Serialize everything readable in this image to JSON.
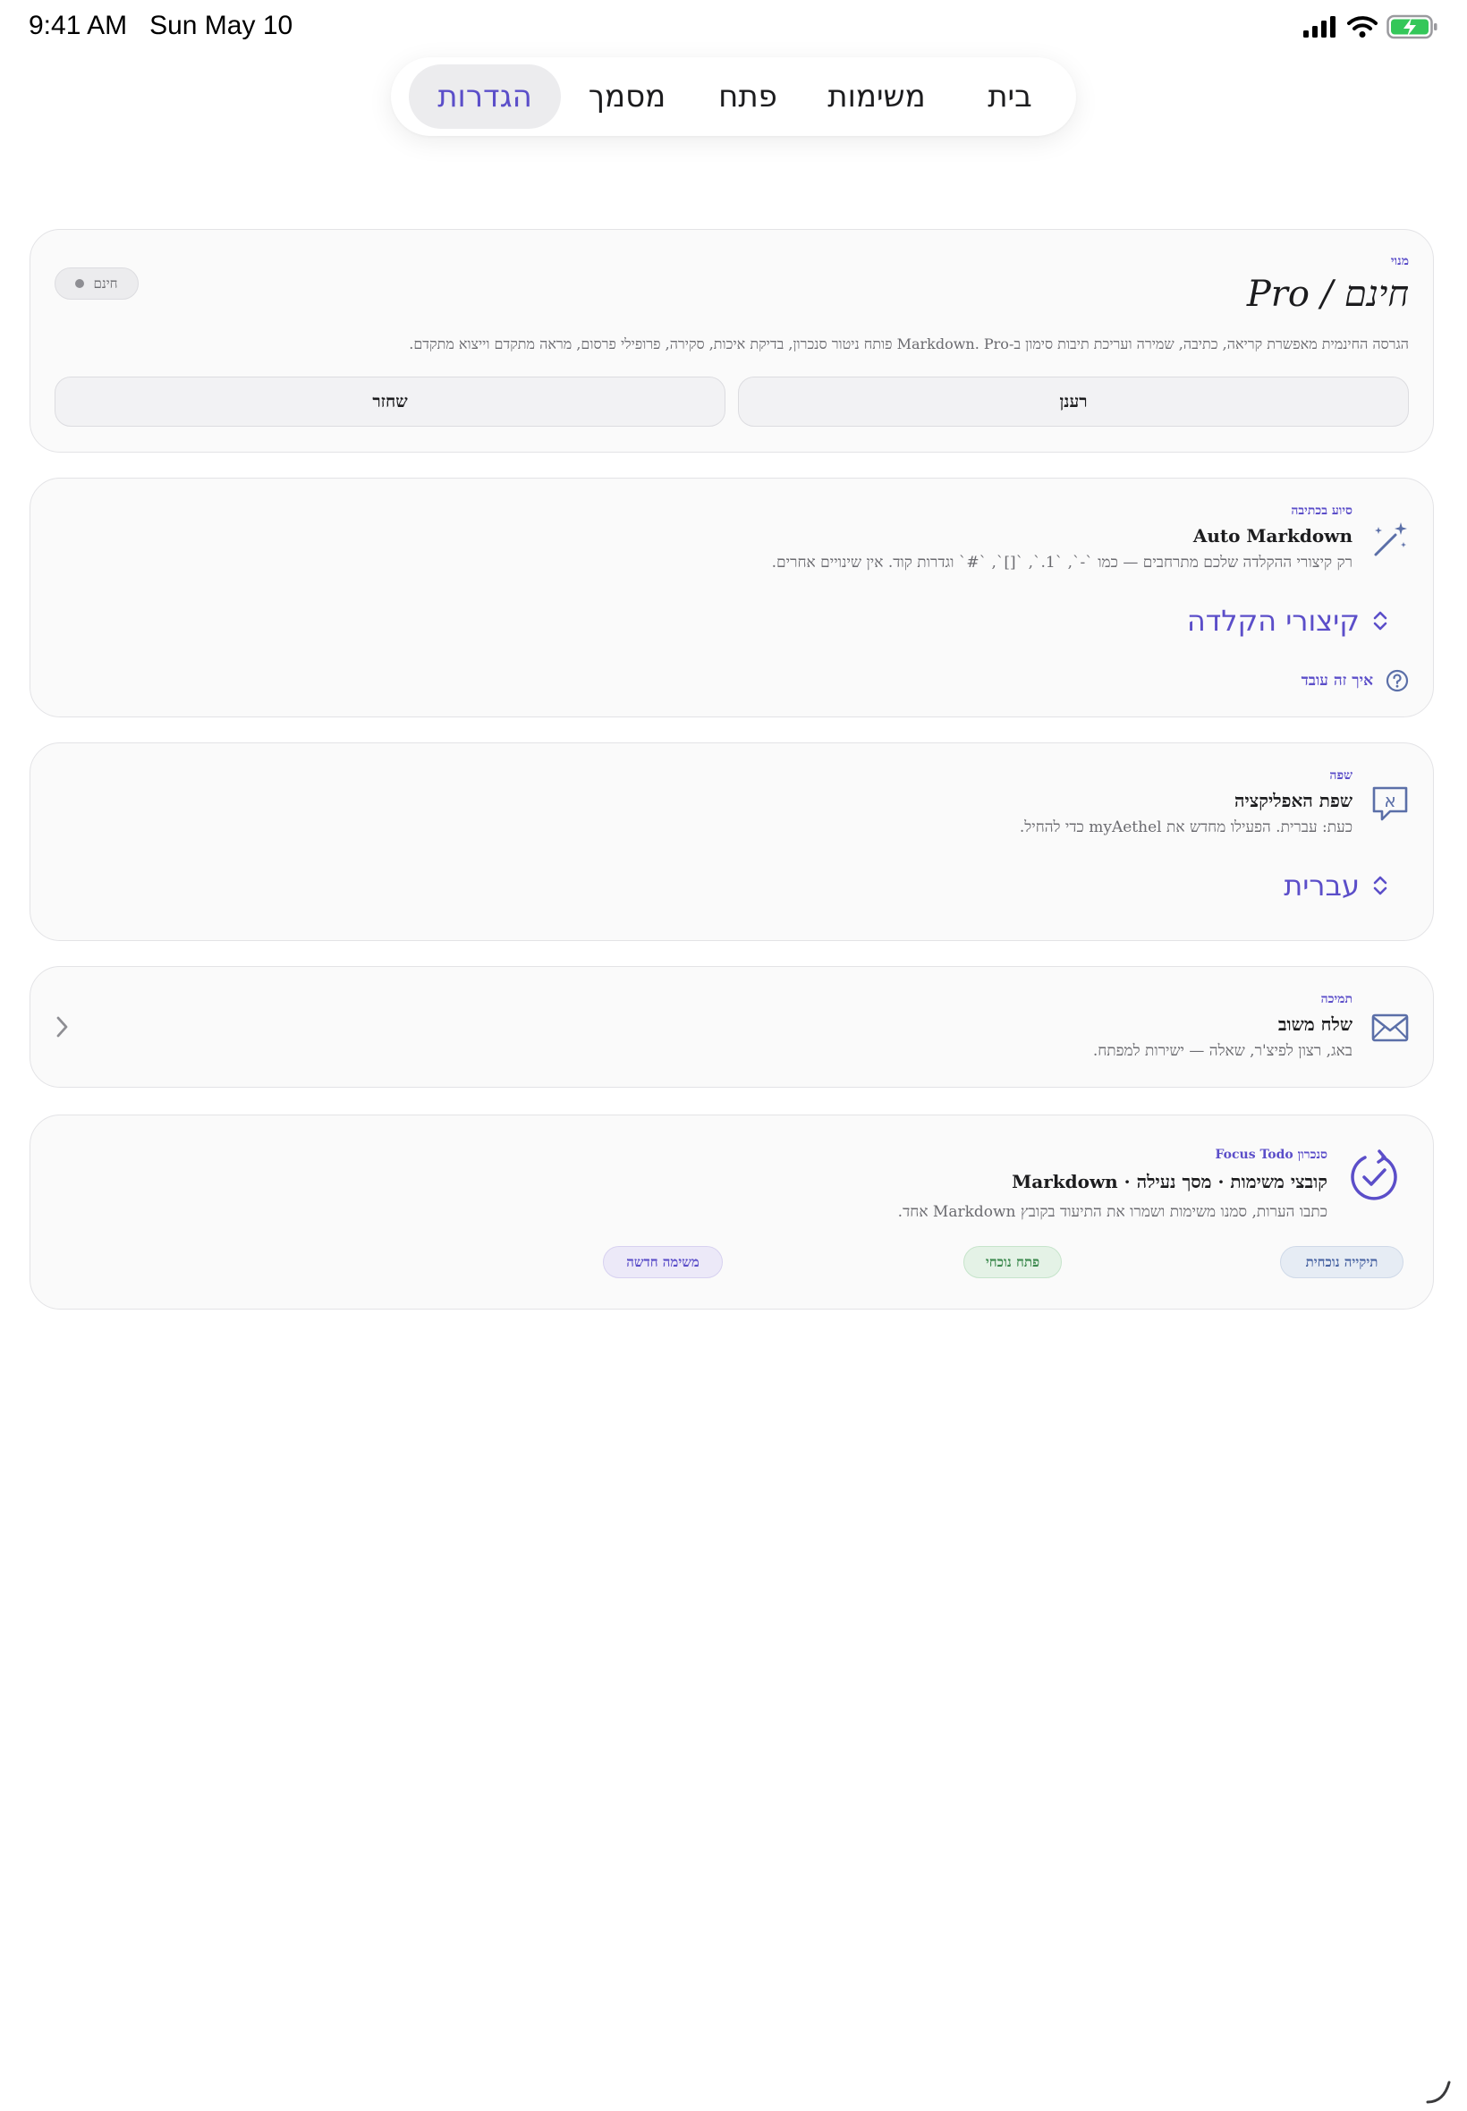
{
  "status_bar": {
    "time": "9:41 AM",
    "date": "Sun May 10",
    "battery_color": "#34c759"
  },
  "tabs": [
    {
      "label": "בית",
      "active": false
    },
    {
      "label": "משימות",
      "active": false
    },
    {
      "label": "פתח",
      "active": false
    },
    {
      "label": "מסמך",
      "active": false
    },
    {
      "label": "הגדרות",
      "active": true
    }
  ],
  "accent_color": "#5b4ec9",
  "plan": {
    "eyebrow": "מנוי",
    "title": "חינם / Pro",
    "description": "הגרסה החינמית מאפשרת קריאה, כתיבה, שמירה ועריכת תיבות סימון ב-Markdown. Pro פותח ניטור סנכרון, בדיקת איכות, סקירה, פרופילי פרסום, מראה מתקדם וייצוא מתקדם.",
    "badge": "חינם",
    "refresh_button": "רענן",
    "restore_button": "שחזר"
  },
  "writing_assist": {
    "eyebrow": "סיוע בכתיבה",
    "title": "Auto Markdown",
    "description": "רק קיצורי ההקלדה שלכם מתרחבים — כמו `-`, `1.`, `[]`, `#` וגדרות קוד. אין שינויים אחרים.",
    "icon": "magic-wand-icon",
    "picker_value": "קיצורי הקלדה",
    "help_link": "איך זה עובד"
  },
  "language": {
    "eyebrow": "שפה",
    "title": "שפת האפליקציה",
    "description": "כעת: עברית. הפעילו מחדש את myAethel כדי להחיל.",
    "icon": "hebrew-language-icon",
    "picker_value": "עברית"
  },
  "support": {
    "eyebrow": "תמיכה",
    "title": "שלח משוב",
    "description": "באג, רצון לפיצ'ר, שאלה — ישירות למפתח.",
    "icon": "envelope-icon"
  },
  "sync": {
    "eyebrow": "סנכרון Focus Todo",
    "title": "קובצי משימות · מסך נעילה · Markdown",
    "description": "כתבו הערות, סמנו משימות ושמרו את התיעוד בקובץ Markdown אחד.",
    "icon": "sync-check-icon",
    "chips": [
      "תיקייה נוכחית",
      "פתח נוכחי",
      "משימה חדשה"
    ]
  }
}
